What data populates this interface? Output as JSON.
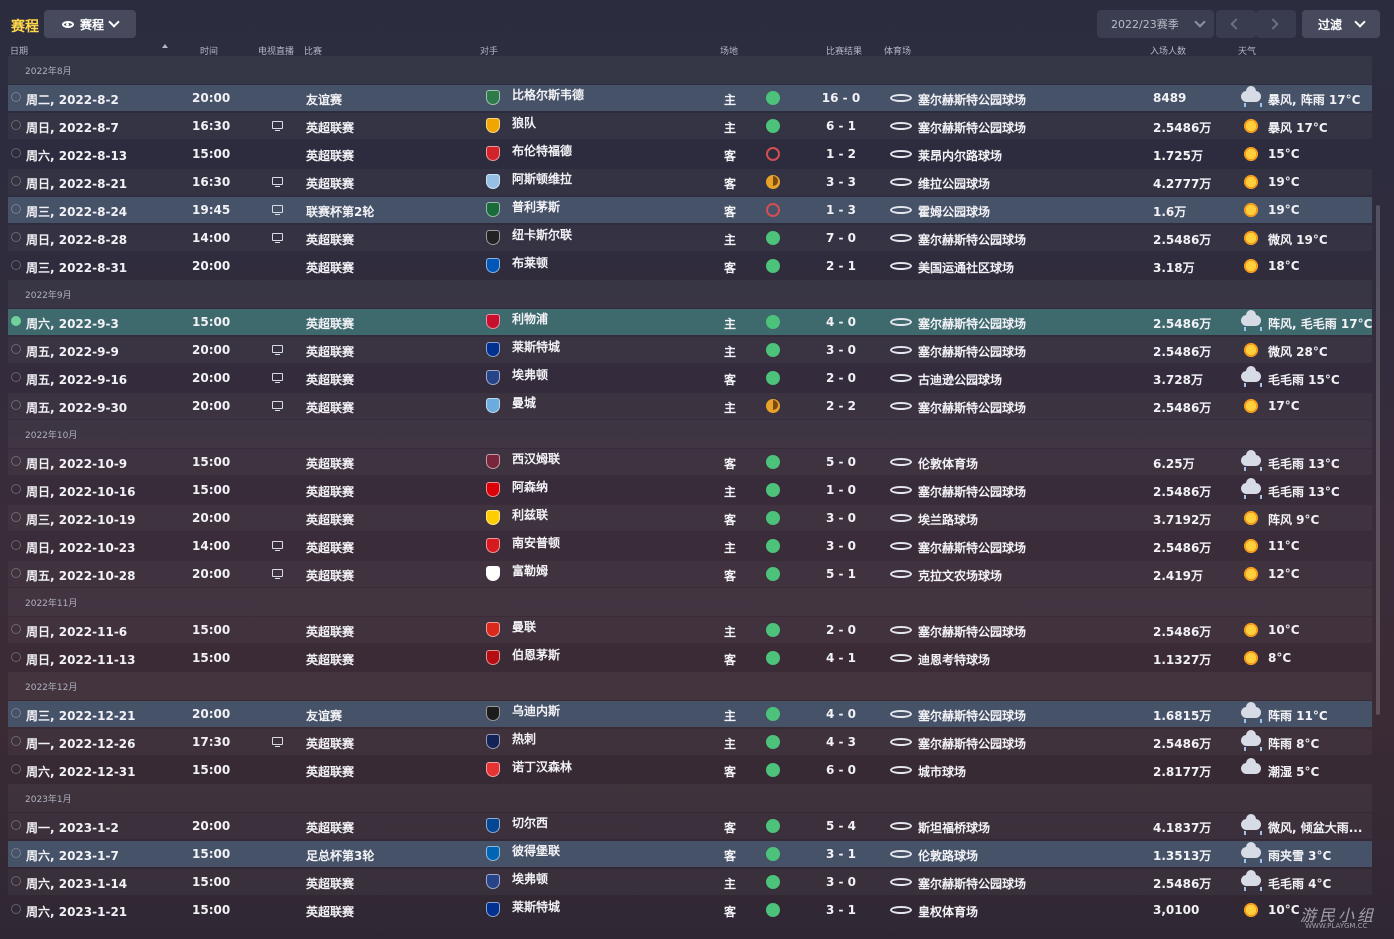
{
  "topbar": {
    "title": "赛程",
    "view_label": "赛程",
    "season_label": "2022/23赛季",
    "filter_label": "过滤"
  },
  "headers": {
    "date": "日期",
    "time": "时间",
    "tv": "电视直播",
    "competition": "比赛",
    "opponent": "对手",
    "venue": "场地",
    "result": "比赛结果",
    "stadium": "体育场",
    "attendance": "入场人数",
    "weather": "天气"
  },
  "groups": [
    {
      "month": "2022年8月",
      "matches": [
        {
          "date": "周二, 2022-8-2",
          "time": "20:00",
          "tv": false,
          "comp": "友谊赛",
          "opp": "比格尔斯韦德",
          "venue": "主",
          "result": "win",
          "score": "16 - 0",
          "stadium": "塞尔赫斯特公园球场",
          "att": "8489",
          "wx": "storm",
          "wxt": "暴风, 阵雨 17°C",
          "crest": "#2f7a4b",
          "style": "hl"
        },
        {
          "date": "周日, 2022-8-7",
          "time": "16:30",
          "tv": true,
          "comp": "英超联赛",
          "opp": "狼队",
          "venue": "主",
          "result": "win",
          "score": "6 - 1",
          "stadium": "塞尔赫斯特公园球场",
          "att": "2.5486万",
          "wx": "sun",
          "wxt": "暴风 17°C",
          "crest": "#f0a500",
          "style": "alt"
        },
        {
          "date": "周六, 2022-8-13",
          "time": "15:00",
          "tv": false,
          "comp": "英超联赛",
          "opp": "布伦特福德",
          "venue": "客",
          "result": "loss",
          "score": "1 - 2",
          "stadium": "莱昂内尔路球场",
          "att": "1.725万",
          "wx": "sun",
          "wxt": "15°C",
          "crest": "#d2232a",
          "style": ""
        },
        {
          "date": "周日, 2022-8-21",
          "time": "16:30",
          "tv": true,
          "comp": "英超联赛",
          "opp": "阿斯顿维拉",
          "venue": "客",
          "result": "draw",
          "score": "3 - 3",
          "stadium": "维拉公园球场",
          "att": "4.2777万",
          "wx": "sun",
          "wxt": "19°C",
          "crest": "#95bfe5",
          "style": "alt"
        },
        {
          "date": "周三, 2022-8-24",
          "time": "19:45",
          "tv": true,
          "comp": "联赛杯第2轮",
          "opp": "普利茅斯",
          "venue": "客",
          "result": "loss",
          "score": "1 - 3",
          "stadium": "霍姆公园球场",
          "att": "1.6万",
          "wx": "sun",
          "wxt": "19°C",
          "crest": "#1a6b3a",
          "style": "hl"
        },
        {
          "date": "周日, 2022-8-28",
          "time": "14:00",
          "tv": true,
          "comp": "英超联赛",
          "opp": "纽卡斯尔联",
          "venue": "主",
          "result": "win",
          "score": "7 - 0",
          "stadium": "塞尔赫斯特公园球场",
          "att": "2.5486万",
          "wx": "sun",
          "wxt": "微风 19°C",
          "crest": "#222222",
          "style": "alt"
        },
        {
          "date": "周三, 2022-8-31",
          "time": "20:00",
          "tv": false,
          "comp": "英超联赛",
          "opp": "布莱顿",
          "venue": "客",
          "result": "win",
          "score": "2 - 1",
          "stadium": "美国运通社区球场",
          "att": "3.18万",
          "wx": "sun",
          "wxt": "18°C",
          "crest": "#0057b8",
          "style": ""
        }
      ]
    },
    {
      "month": "2022年9月",
      "matches": [
        {
          "date": "周六, 2022-9-3",
          "time": "15:00",
          "tv": false,
          "comp": "英超联赛",
          "opp": "利物浦",
          "venue": "主",
          "result": "win",
          "score": "4 - 0",
          "stadium": "塞尔赫斯特公园球场",
          "att": "2.5486万",
          "wx": "rain",
          "wxt": "阵风, 毛毛雨 17°C",
          "crest": "#c8102e",
          "style": "sel"
        },
        {
          "date": "周五, 2022-9-9",
          "time": "20:00",
          "tv": true,
          "comp": "英超联赛",
          "opp": "莱斯特城",
          "venue": "主",
          "result": "win",
          "score": "3 - 0",
          "stadium": "塞尔赫斯特公园球场",
          "att": "2.5486万",
          "wx": "sun",
          "wxt": "微风 28°C",
          "crest": "#003090",
          "style": "alt"
        },
        {
          "date": "周五, 2022-9-16",
          "time": "20:00",
          "tv": true,
          "comp": "英超联赛",
          "opp": "埃弗顿",
          "venue": "客",
          "result": "win",
          "score": "2 - 0",
          "stadium": "古迪逊公园球场",
          "att": "3.728万",
          "wx": "rain",
          "wxt": "毛毛雨 15°C",
          "crest": "#274488",
          "style": ""
        },
        {
          "date": "周五, 2022-9-30",
          "time": "20:00",
          "tv": true,
          "comp": "英超联赛",
          "opp": "曼城",
          "venue": "主",
          "result": "draw",
          "score": "2 - 2",
          "stadium": "塞尔赫斯特公园球场",
          "att": "2.5486万",
          "wx": "sun",
          "wxt": "17°C",
          "crest": "#6cabdd",
          "style": "alt"
        }
      ]
    },
    {
      "month": "2022年10月",
      "matches": [
        {
          "date": "周日, 2022-10-9",
          "time": "15:00",
          "tv": false,
          "comp": "英超联赛",
          "opp": "西汉姆联",
          "venue": "客",
          "result": "win",
          "score": "5 - 0",
          "stadium": "伦敦体育场",
          "att": "6.25万",
          "wx": "rain",
          "wxt": "毛毛雨 13°C",
          "crest": "#7a263a",
          "style": "alt"
        },
        {
          "date": "周日, 2022-10-16",
          "time": "15:00",
          "tv": false,
          "comp": "英超联赛",
          "opp": "阿森纳",
          "venue": "主",
          "result": "win",
          "score": "1 - 0",
          "stadium": "塞尔赫斯特公园球场",
          "att": "2.5486万",
          "wx": "rain",
          "wxt": "毛毛雨 13°C",
          "crest": "#db0007",
          "style": ""
        },
        {
          "date": "周三, 2022-10-19",
          "time": "20:00",
          "tv": false,
          "comp": "英超联赛",
          "opp": "利兹联",
          "venue": "客",
          "result": "win",
          "score": "3 - 0",
          "stadium": "埃兰路球场",
          "att": "3.7192万",
          "wx": "sun",
          "wxt": "阵风 9°C",
          "crest": "#ffcd00",
          "style": "alt"
        },
        {
          "date": "周日, 2022-10-23",
          "time": "14:00",
          "tv": true,
          "comp": "英超联赛",
          "opp": "南安普顿",
          "venue": "主",
          "result": "win",
          "score": "3 - 0",
          "stadium": "塞尔赫斯特公园球场",
          "att": "2.5486万",
          "wx": "sun",
          "wxt": "11°C",
          "crest": "#d71920",
          "style": ""
        },
        {
          "date": "周五, 2022-10-28",
          "time": "20:00",
          "tv": true,
          "comp": "英超联赛",
          "opp": "富勒姆",
          "venue": "客",
          "result": "win",
          "score": "5 - 1",
          "stadium": "克拉文农场球场",
          "att": "2.419万",
          "wx": "sun",
          "wxt": "12°C",
          "crest": "#ffffff",
          "style": "alt"
        }
      ]
    },
    {
      "month": "2022年11月",
      "matches": [
        {
          "date": "周日, 2022-11-6",
          "time": "15:00",
          "tv": false,
          "comp": "英超联赛",
          "opp": "曼联",
          "venue": "主",
          "result": "win",
          "score": "2 - 0",
          "stadium": "塞尔赫斯特公园球场",
          "att": "2.5486万",
          "wx": "sun",
          "wxt": "10°C",
          "crest": "#da291c",
          "style": "alt"
        },
        {
          "date": "周日, 2022-11-13",
          "time": "15:00",
          "tv": false,
          "comp": "英超联赛",
          "opp": "伯恩茅斯",
          "venue": "客",
          "result": "win",
          "score": "4 - 1",
          "stadium": "迪恩考特球场",
          "att": "1.1327万",
          "wx": "sun",
          "wxt": "8°C",
          "crest": "#b50e12",
          "style": ""
        }
      ]
    },
    {
      "month": "2022年12月",
      "matches": [
        {
          "date": "周三, 2022-12-21",
          "time": "20:00",
          "tv": false,
          "comp": "友谊赛",
          "opp": "乌迪内斯",
          "venue": "主",
          "result": "win",
          "score": "4 - 0",
          "stadium": "塞尔赫斯特公园球场",
          "att": "1.6815万",
          "wx": "storm",
          "wxt": "阵雨 11°C",
          "crest": "#1c1c1c",
          "style": "hl"
        },
        {
          "date": "周一, 2022-12-26",
          "time": "17:30",
          "tv": true,
          "comp": "英超联赛",
          "opp": "热刺",
          "venue": "主",
          "result": "win",
          "score": "4 - 3",
          "stadium": "塞尔赫斯特公园球场",
          "att": "2.5486万",
          "wx": "storm",
          "wxt": "阵雨 8°C",
          "crest": "#132257",
          "style": "alt"
        },
        {
          "date": "周六, 2022-12-31",
          "time": "15:00",
          "tv": false,
          "comp": "英超联赛",
          "opp": "诺丁汉森林",
          "venue": "客",
          "result": "win",
          "score": "6 - 0",
          "stadium": "城市球场",
          "att": "2.8177万",
          "wx": "cloud",
          "wxt": "潮湿 5°C",
          "crest": "#e53233",
          "style": ""
        }
      ]
    },
    {
      "month": "2023年1月",
      "matches": [
        {
          "date": "周一, 2023-1-2",
          "time": "20:00",
          "tv": false,
          "comp": "英超联赛",
          "opp": "切尔西",
          "venue": "客",
          "result": "win",
          "score": "5 - 4",
          "stadium": "斯坦福桥球场",
          "att": "4.1837万",
          "wx": "rain",
          "wxt": "微风, 倾盆大雨...",
          "crest": "#034694",
          "style": "alt"
        },
        {
          "date": "周六, 2023-1-7",
          "time": "15:00",
          "tv": false,
          "comp": "足总杯第3轮",
          "opp": "彼得堡联",
          "venue": "客",
          "result": "win",
          "score": "3 - 1",
          "stadium": "伦敦路球场",
          "att": "1.3513万",
          "wx": "rain",
          "wxt": "雨夹雪 3°C",
          "crest": "#0066b3",
          "style": "hl"
        },
        {
          "date": "周六, 2023-1-14",
          "time": "15:00",
          "tv": false,
          "comp": "英超联赛",
          "opp": "埃弗顿",
          "venue": "主",
          "result": "win",
          "score": "3 - 0",
          "stadium": "塞尔赫斯特公园球场",
          "att": "2.5486万",
          "wx": "rain",
          "wxt": "毛毛雨 4°C",
          "crest": "#274488",
          "style": "alt"
        },
        {
          "date": "周六, 2023-1-21",
          "time": "15:00",
          "tv": false,
          "comp": "英超联赛",
          "opp": "莱斯特城",
          "venue": "客",
          "result": "win",
          "score": "3 - 1",
          "stadium": "皇权体育场",
          "att": "3,0100",
          "wx": "sun",
          "wxt": "10°C",
          "crest": "#003090",
          "style": ""
        }
      ]
    }
  ],
  "watermark": {
    "text": "游民小组",
    "sub": "WWW.PLAYGM.CC"
  }
}
